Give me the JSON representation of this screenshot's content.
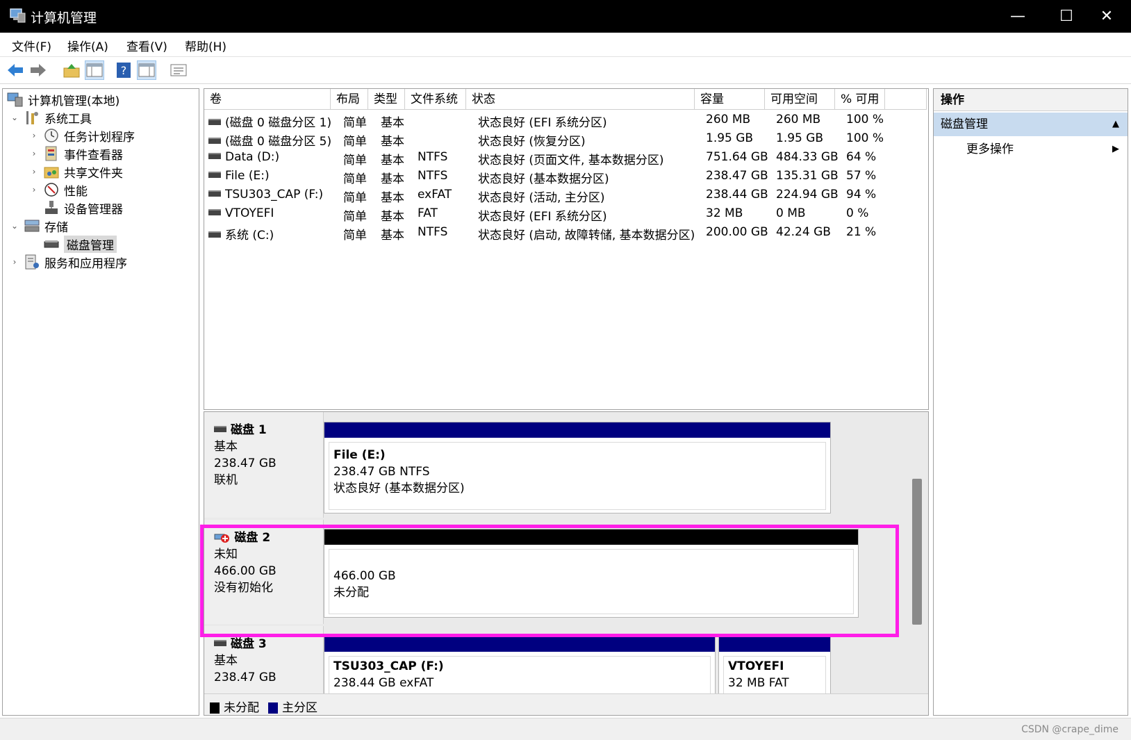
{
  "window": {
    "title": "计算机管理",
    "controls": {
      "minimize": "—",
      "maximize": "☐",
      "close": "✕"
    }
  },
  "menu": {
    "items": [
      "文件(F)",
      "操作(A)",
      "查看(V)",
      "帮助(H)"
    ]
  },
  "toolbar": {
    "icons": [
      "back-arrow-icon",
      "forward-arrow-icon",
      "up-folder-icon",
      "show-hide-tree-icon",
      "help-icon",
      "show-hide-action-pane-icon",
      "properties-icon"
    ]
  },
  "tree": {
    "root": "计算机管理(本地)",
    "system_tools": "系统工具",
    "task_scheduler": "任务计划程序",
    "event_viewer": "事件查看器",
    "shared_folders": "共享文件夹",
    "performance": "性能",
    "device_manager": "设备管理器",
    "storage": "存储",
    "disk_management": "磁盘管理",
    "services_apps": "服务和应用程序"
  },
  "volumes": {
    "headers": [
      "卷",
      "布局",
      "类型",
      "文件系统",
      "状态",
      "容量",
      "可用空间",
      "% 可用"
    ],
    "rows": [
      [
        "(磁盘 0 磁盘分区 1)",
        "简单",
        "基本",
        "",
        "状态良好 (EFI 系统分区)",
        "260 MB",
        "260 MB",
        "100 %"
      ],
      [
        "(磁盘 0 磁盘分区 5)",
        "简单",
        "基本",
        "",
        "状态良好 (恢复分区)",
        "1.95 GB",
        "1.95 GB",
        "100 %"
      ],
      [
        "Data (D:)",
        "简单",
        "基本",
        "NTFS",
        "状态良好 (页面文件, 基本数据分区)",
        "751.64 GB",
        "484.33 GB",
        "64 %"
      ],
      [
        "File (E:)",
        "简单",
        "基本",
        "NTFS",
        "状态良好 (基本数据分区)",
        "238.47 GB",
        "135.31 GB",
        "57 %"
      ],
      [
        "TSU303_CAP (F:)",
        "简单",
        "基本",
        "exFAT",
        "状态良好 (活动, 主分区)",
        "238.44 GB",
        "224.94 GB",
        "94 %"
      ],
      [
        "VTOYEFI",
        "简单",
        "基本",
        "FAT",
        "状态良好 (EFI 系统分区)",
        "32 MB",
        "0 MB",
        "0 %"
      ],
      [
        "系统 (C:)",
        "简单",
        "基本",
        "NTFS",
        "状态良好 (启动, 故障转储, 基本数据分区)",
        "200.00 GB",
        "42.24 GB",
        "21 %"
      ]
    ]
  },
  "disks": {
    "disk1": {
      "name": "磁盘 1",
      "type": "基本",
      "size": "238.47 GB",
      "status": "联机",
      "part": {
        "title": "File  (E:)",
        "info": "238.47 GB NTFS",
        "status": "状态良好 (基本数据分区)"
      }
    },
    "disk2": {
      "name": "磁盘 2",
      "type": "未知",
      "size": "466.00 GB",
      "status": "没有初始化",
      "part": {
        "size": "466.00 GB",
        "status": "未分配"
      }
    },
    "disk3": {
      "name": "磁盘 3",
      "type": "基本",
      "size": "238.47 GB",
      "part1": {
        "title": "TSU303_CAP  (F:)",
        "info": "238.44 GB exFAT"
      },
      "part2": {
        "title": "VTOYEFI",
        "info": "32 MB FAT"
      }
    }
  },
  "legend": {
    "unallocated": "未分配",
    "primary": "主分区"
  },
  "colors": {
    "primary_partition": "#000080",
    "unallocated": "#000000",
    "highlight": "#ff1ee8",
    "action_section": "#c8dbef"
  },
  "actions": {
    "header": "操作",
    "section": "磁盘管理",
    "more": "更多操作"
  },
  "status": {
    "watermark": "CSDN @crape_dime"
  }
}
